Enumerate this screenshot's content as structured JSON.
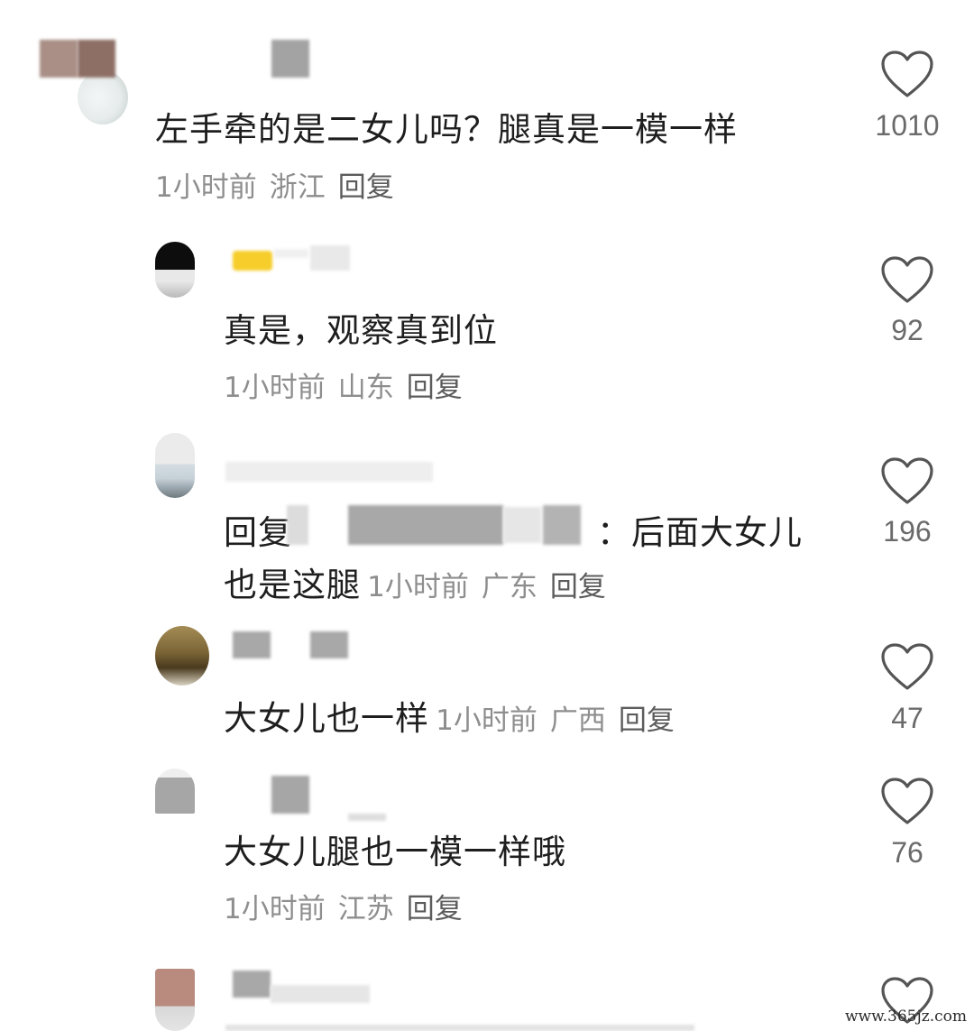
{
  "comments": [
    {
      "text": "左手牵的是二女儿吗？腿真是一模一样",
      "time": "1小时前",
      "location": "浙江",
      "reply": "回复",
      "likes": "1010"
    },
    {
      "text": "真是，观察真到位",
      "time": "1小时前",
      "location": "山东",
      "reply": "回复",
      "likes": "92"
    },
    {
      "reply_prefix": "回复",
      "text_after_mention": "：后面大女儿",
      "text_line2": "也是这腿",
      "time": "1小时前",
      "location": "广东",
      "reply": "回复",
      "likes": "196"
    },
    {
      "text": "大女儿也一样",
      "time": "1小时前",
      "location": "广西",
      "reply": "回复",
      "likes": "47"
    },
    {
      "text": "大女儿腿也一模一样哦",
      "time": "1小时前",
      "location": "江苏",
      "reply": "回复",
      "likes": "76"
    }
  ],
  "watermark": "www.365jz.com",
  "icons": {
    "like": "heart-outline-icon"
  },
  "colors": {
    "text": "#1e1e1e",
    "meta": "#8e8e8e",
    "reply": "#5c5c5c",
    "heart": "#555555"
  }
}
